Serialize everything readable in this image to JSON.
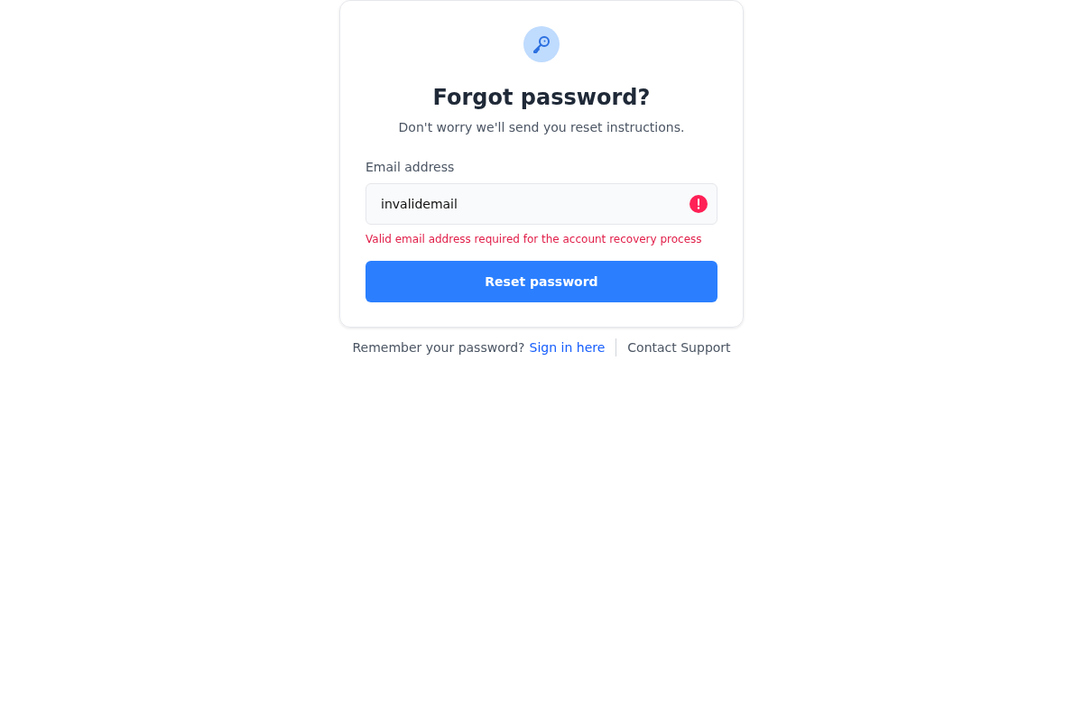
{
  "card": {
    "title": "Forgot password?",
    "subtitle": "Don't worry we'll send you reset instructions.",
    "email_field": {
      "label": "Email address",
      "value": "invalidemail",
      "invalid": true,
      "error": "Valid email address required for the account recovery process"
    },
    "submit_button": "Reset password"
  },
  "footer": {
    "prompt": "Remember your password?",
    "sign_in_link": "Sign in here",
    "support_link": "Contact Support"
  }
}
